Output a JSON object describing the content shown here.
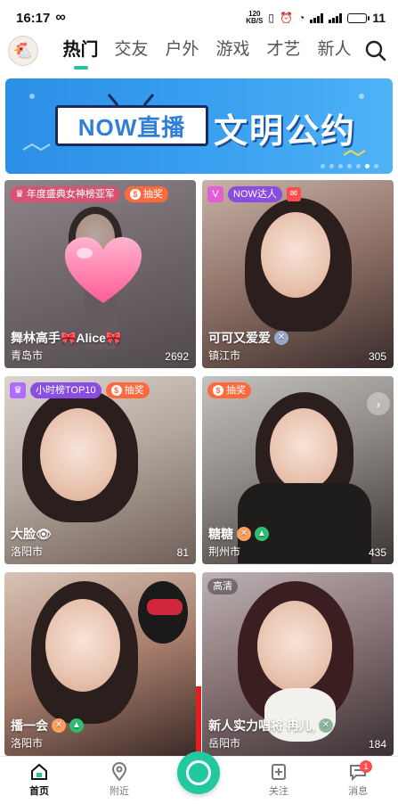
{
  "status_bar": {
    "time": "16:17",
    "net_speed_top": "120",
    "net_speed_bottom": "KB/S",
    "battery_level": "11"
  },
  "top_nav": {
    "tabs": [
      {
        "label": "热门",
        "active": true
      },
      {
        "label": "交友",
        "active": false
      },
      {
        "label": "户外",
        "active": false
      },
      {
        "label": "游戏",
        "active": false
      },
      {
        "label": "才艺",
        "active": false
      },
      {
        "label": "新人",
        "active": false
      }
    ]
  },
  "banner": {
    "now_label": "NOW直播",
    "pact_label": "文明公约"
  },
  "cards": [
    {
      "top_tag": "年度盛典女神榜亚军",
      "lottery": "抽奖",
      "name": "舞林高手🎀Alice🎀",
      "city": "青岛市",
      "count": "2692"
    },
    {
      "top_tag": "NOW达人",
      "name": "可可又爱爱",
      "city": "镇江市",
      "count": "305"
    },
    {
      "top_tag": "小时榜TOP10",
      "lottery": "抽奖",
      "name": "大脸👁",
      "city": "洛阳市",
      "count": "81"
    },
    {
      "lottery": "抽奖",
      "name": "糖糖",
      "city": "荆州市",
      "count": "435"
    },
    {
      "name": "播一会",
      "city": "洛阳市",
      "count": ""
    },
    {
      "hd_tag": "高清",
      "name": "新人实力唱将 冉儿,",
      "city": "岳阳市",
      "count": "184"
    }
  ],
  "bottom_nav": {
    "home": "首页",
    "nearby": "附近",
    "follow": "关注",
    "messages": "消息",
    "message_badge": "1"
  },
  "colors": {
    "accent": "#22c29a",
    "lottery": "#ff6a3d",
    "banner_blue": "#3aa0f0",
    "badge_red": "#ff4d4f"
  }
}
